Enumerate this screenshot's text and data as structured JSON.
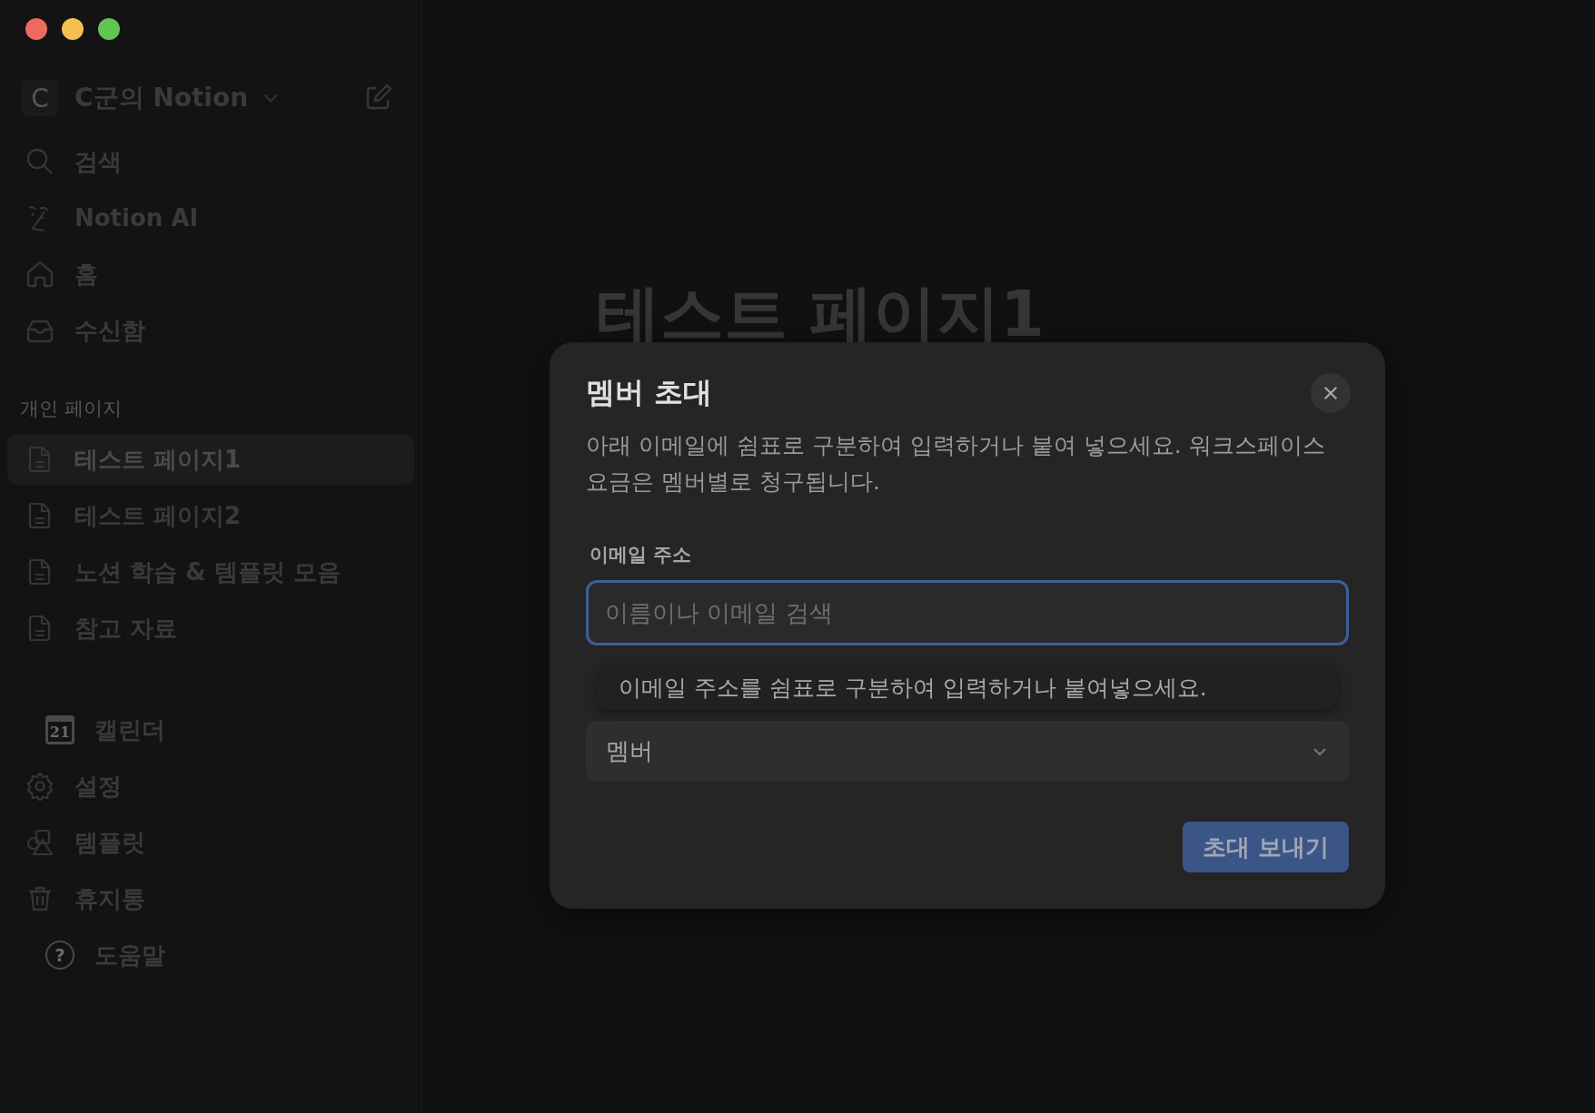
{
  "sidebar": {
    "workspace": {
      "initial": "C",
      "name": "C군의 Notion"
    },
    "nav_items": [
      {
        "kind": "search",
        "label": "검색"
      },
      {
        "kind": "ai",
        "label": "Notion AI"
      },
      {
        "kind": "home",
        "label": "홈"
      },
      {
        "kind": "inbox",
        "label": "수신함"
      }
    ],
    "section_label": "개인 페이지",
    "pages": [
      {
        "label": "테스트 페이지1",
        "selected": true
      },
      {
        "label": "테스트 페이지2",
        "selected": false
      },
      {
        "label": "노션 학습 & 템플릿 모음",
        "selected": false
      },
      {
        "label": "참고 자료",
        "selected": false
      }
    ],
    "bottom_items": [
      {
        "kind": "calendar",
        "label": "캘린더",
        "icon_text": "21"
      },
      {
        "kind": "settings",
        "label": "설정"
      },
      {
        "kind": "templates",
        "label": "템플릿"
      },
      {
        "kind": "trash",
        "label": "휴지통"
      },
      {
        "kind": "help",
        "label": "도움말",
        "icon_text": "?"
      }
    ]
  },
  "page_title": "테스트 페이지1",
  "dialog": {
    "title": "멤버 초대",
    "description": "아래 이메일에 쉼표로 구분하여 입력하거나 붙여 넣으세요. 워크스페이스 요금은 멤버별로 청구됩니다.",
    "email_label": "이메일 주소",
    "email_field": {
      "placeholder": "이름이나 이메일 검색"
    },
    "tooltip": "이메일 주소를 쉼표로 구분하여 입력하거나 붙여넣으세요.",
    "role_select": {
      "value": "멤버"
    },
    "submit_button": "초대 보내기"
  }
}
